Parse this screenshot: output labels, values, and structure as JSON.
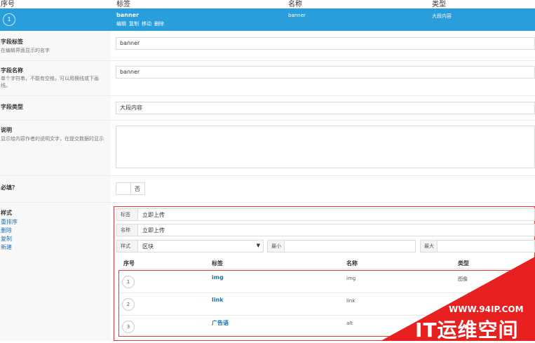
{
  "header": {
    "col_index": "序号",
    "col_label": "标签",
    "col_name": "名称",
    "col_type": "类型"
  },
  "selected_row": {
    "index": "1",
    "label": "banner",
    "actions": [
      "编辑",
      "复制",
      "移动",
      "删除"
    ],
    "name": "banner",
    "type": "大段内容"
  },
  "field_label": {
    "title": "字段标签",
    "desc": "在编辑界面显示的名字",
    "value": "banner"
  },
  "field_name": {
    "title": "字段名称",
    "desc": "单个字符串，不能有空格，可以用横线或下画线。",
    "value": "banner"
  },
  "field_type": {
    "title": "字段类型",
    "value": "大段内容"
  },
  "instructions": {
    "title": "说明",
    "desc": "显示给内容作者的说明文字，在提交数据时显示",
    "value": ""
  },
  "required": {
    "title": "必填？",
    "toggle_text": "否"
  },
  "style": {
    "title": "样式",
    "links": [
      "重排序",
      "删除",
      "复制",
      "新建"
    ],
    "panel": {
      "label_key": "标签",
      "label_value": "立即上传",
      "name_key": "名称",
      "name_value": "立即上传",
      "style_key": "样式",
      "style_value": "区块",
      "min_label": "最小",
      "max_label": "最大"
    },
    "table": {
      "headers": [
        "序号",
        "标签",
        "名称",
        "类型"
      ],
      "rows": [
        {
          "index": "1",
          "label": "img",
          "name": "img",
          "type": "图像"
        },
        {
          "index": "2",
          "label": "link",
          "name": "link",
          "type": ""
        },
        {
          "index": "3",
          "label": "广告语",
          "name": "alt",
          "type": ""
        }
      ]
    }
  },
  "watermark": {
    "url": "WWW.94IP.COM",
    "text": "IT运维空间"
  },
  "colors": {
    "accent": "#2a9ddb",
    "highlight_border": "#e23b3b",
    "watermark": "#e8201f"
  }
}
